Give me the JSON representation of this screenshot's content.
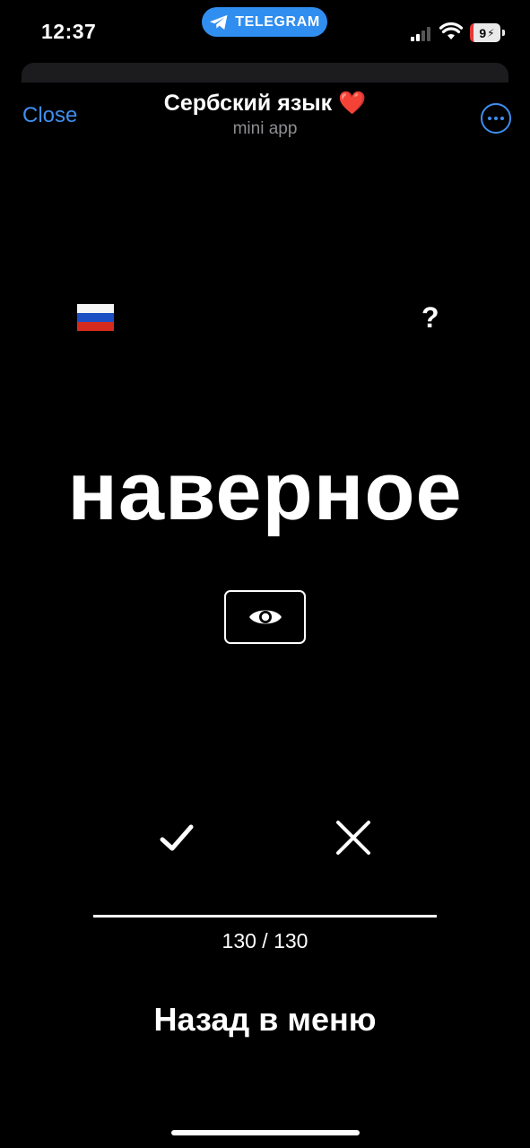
{
  "status_bar": {
    "time": "12:37",
    "app_pill": {
      "label": "TELEGRAM",
      "icon": "telegram-plane-icon",
      "color": "#2f8ef0"
    },
    "signal_icon": "cellular-signal-icon",
    "wifi_icon": "wifi-icon",
    "battery": {
      "level_text": "9",
      "icon": "battery-charging-icon"
    }
  },
  "header": {
    "close_label": "Close",
    "title": "Сербский язык ❤️",
    "subtitle": "mini app",
    "more_icon": "more-options-icon",
    "accent_color": "#3e8ef0"
  },
  "card": {
    "language_flag": "russian-flag-icon",
    "help_label": "?",
    "word": "наверное",
    "reveal_icon": "eye-icon",
    "correct_icon": "checkmark-icon",
    "wrong_icon": "cross-icon"
  },
  "progress": {
    "counter": "130 / 130",
    "fraction": 1.0
  },
  "footer": {
    "back_label": "Назад в меню"
  }
}
